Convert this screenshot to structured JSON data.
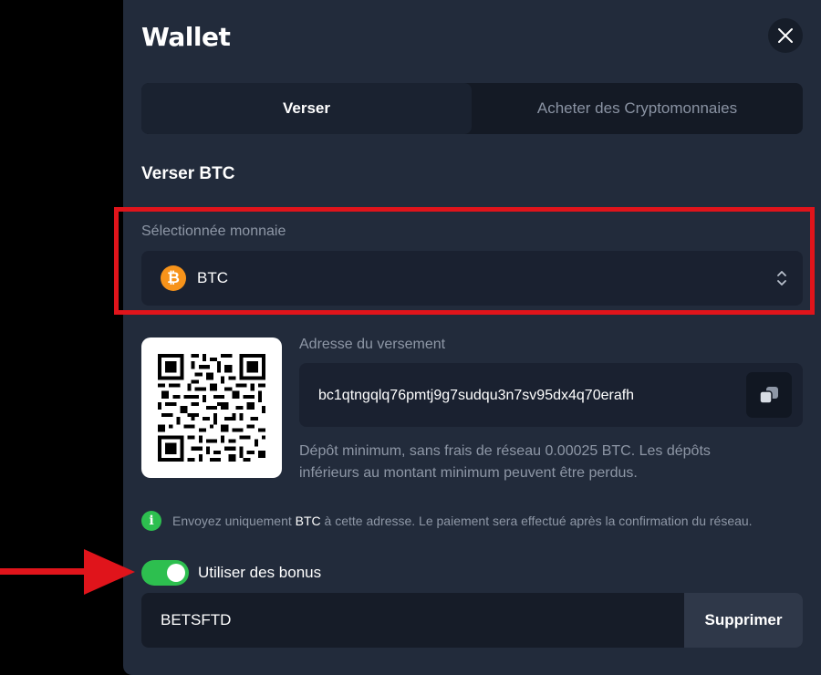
{
  "wallet": {
    "title": "Wallet",
    "close_icon": "close-icon"
  },
  "tabs": [
    {
      "label": "Verser",
      "active": true
    },
    {
      "label": "Acheter des Cryptomonnaies",
      "active": false
    }
  ],
  "deposit": {
    "section_title": "Verser BTC",
    "currency_label": "Sélectionnée monnaie",
    "currency_value": "BTC",
    "currency_icon": "bitcoin-icon",
    "currency_icon_glyph": "₿",
    "address_label": "Adresse du versement",
    "address_value": "bc1qtngqlq76pmtj9g7sudqu3n7sv95dx4q70erafh",
    "copy_icon": "copy-icon",
    "min_note": "Dépôt minimum, sans frais de réseau 0.00025 BTC. Les dépôts inférieurs au montant minimum peuvent être perdus.",
    "info_prefix": "Envoyez uniquement",
    "info_currency": "BTC",
    "info_suffix": "à cette adresse. Le paiement sera effectué après la confirmation du réseau.",
    "info_glyph": "i"
  },
  "bonus": {
    "toggle_on": true,
    "label": "Utiliser des bonus",
    "code_value": "BETSFTD",
    "remove_label": "Supprimer"
  },
  "colors": {
    "accent_green": "#2dbf4f",
    "highlight_red": "#e0141b",
    "bitcoin_orange": "#f7931a",
    "panel_bg": "#222b3b"
  }
}
